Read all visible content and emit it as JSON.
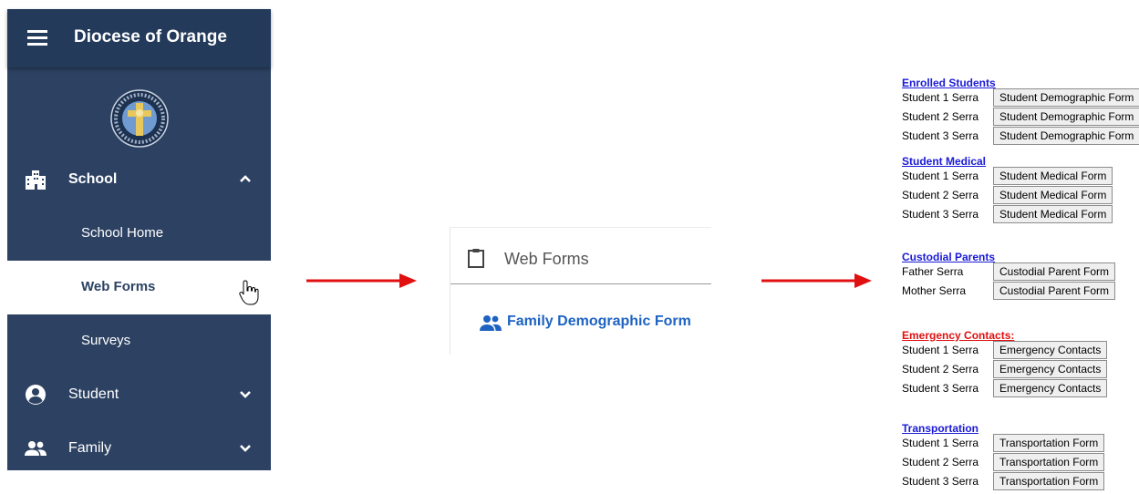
{
  "sidebar": {
    "title": "Diocese of Orange",
    "items": [
      {
        "label": "School",
        "icon": "building-icon",
        "expanded": true
      },
      {
        "label": "School Home"
      },
      {
        "label": "Web Forms",
        "active": true
      },
      {
        "label": "Surveys"
      },
      {
        "label": "Student",
        "icon": "account-circle-icon",
        "expanded": false
      },
      {
        "label": "Family",
        "icon": "people-icon",
        "expanded": false
      }
    ]
  },
  "web_forms_card": {
    "title": "Web Forms",
    "link": "Family Demographic Form"
  },
  "forms_page": {
    "sections": [
      {
        "heading": "Enrolled Students",
        "color": "#1a1ad6",
        "rows": [
          {
            "label": "Student 1 Serra",
            "button": "Student Demographic Form"
          },
          {
            "label": "Student 2 Serra",
            "button": "Student Demographic Form"
          },
          {
            "label": "Student 3 Serra",
            "button": "Student Demographic Form"
          }
        ]
      },
      {
        "heading": "Student Medical",
        "color": "#1a1ad6",
        "rows": [
          {
            "label": "Student 1 Serra",
            "button": "Student Medical Form"
          },
          {
            "label": "Student 2 Serra",
            "button": "Student Medical Form"
          },
          {
            "label": "Student 3 Serra",
            "button": "Student Medical Form"
          }
        ]
      },
      {
        "heading": "Custodial Parents",
        "color": "#1a1ad6",
        "rows": [
          {
            "label": "Father Serra",
            "button": "Custodial Parent Form"
          },
          {
            "label": "Mother Serra",
            "button": "Custodial Parent Form"
          }
        ]
      },
      {
        "heading": "Emergency Contacts:",
        "color": "#e01010",
        "rows": [
          {
            "label": "Student 1 Serra",
            "button": "Emergency Contacts"
          },
          {
            "label": "Student 2 Serra",
            "button": "Emergency Contacts"
          },
          {
            "label": "Student 3 Serra",
            "button": "Emergency Contacts"
          }
        ]
      },
      {
        "heading": "Transportation",
        "color": "#1a1ad6",
        "rows": [
          {
            "label": "Student 1 Serra",
            "button": "Transportation Form"
          },
          {
            "label": "Student 2 Serra",
            "button": "Transportation Form"
          },
          {
            "label": "Student 3 Serra",
            "button": "Transportation Form"
          }
        ]
      }
    ]
  },
  "colors": {
    "sidebar_bg": "#2d4263",
    "sidebar_header_bg": "#233a5b",
    "arrow": "#e01010",
    "link_blue": "#1e63c2"
  }
}
